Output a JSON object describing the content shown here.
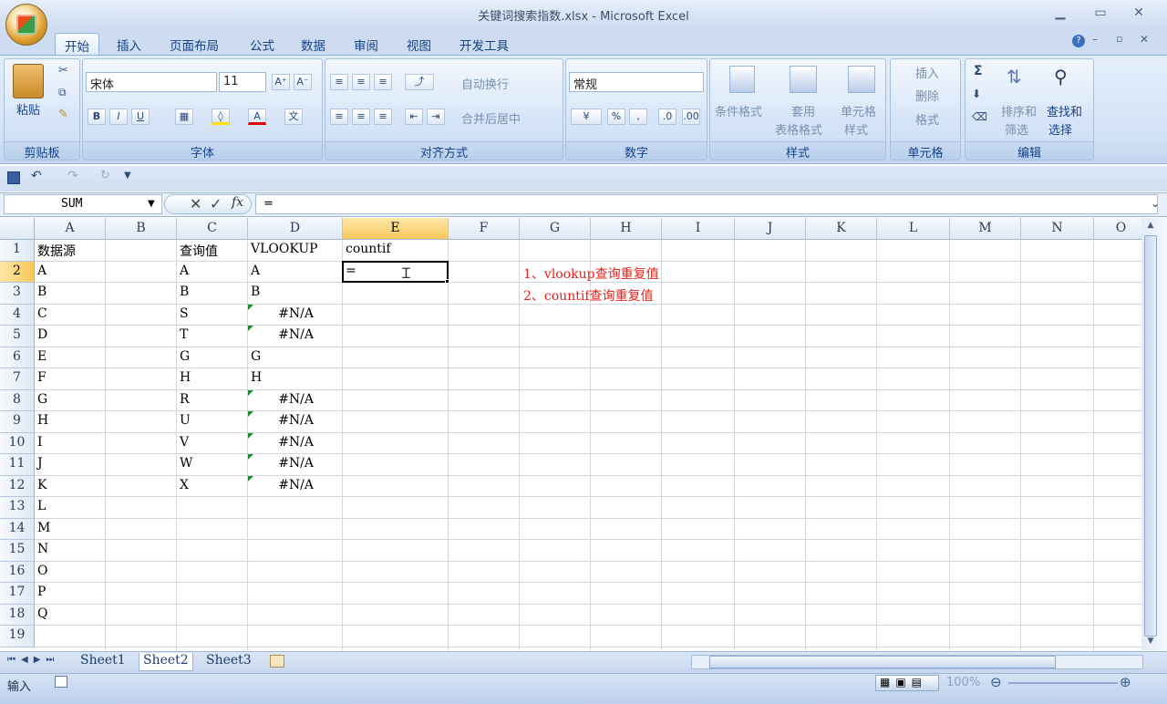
{
  "window": {
    "title": "关键词搜索指数.xlsx - Microsoft Excel"
  },
  "ribbon_tabs": [
    {
      "label": "开始",
      "active": true
    },
    {
      "label": "插入"
    },
    {
      "label": "页面布局"
    },
    {
      "label": "公式"
    },
    {
      "label": "数据"
    },
    {
      "label": "审阅"
    },
    {
      "label": "视图"
    },
    {
      "label": "开发工具"
    }
  ],
  "ribbon": {
    "clipboard": {
      "paste": "粘贴",
      "caption": "剪贴板"
    },
    "font": {
      "name": "宋体",
      "size": "11",
      "caption": "字体"
    },
    "alignment": {
      "wrap": "自动换行",
      "merge": "合并后居中",
      "caption": "对齐方式"
    },
    "number": {
      "format": "常规",
      "caption": "数字"
    },
    "styles": {
      "conditional": "条件格式",
      "table1": "套用",
      "table2": "表格格式",
      "cell1": "单元格",
      "cell2": "样式",
      "caption": "样式"
    },
    "cells": {
      "insert": "插入",
      "delete": "删除",
      "format": "格式",
      "caption": "单元格"
    },
    "editing": {
      "sort1": "排序和",
      "sort2": "筛选",
      "find1": "查找和",
      "find2": "选择",
      "caption": "编辑"
    }
  },
  "formula_bar": {
    "name_box": "SUM",
    "content": "="
  },
  "columns": [
    "A",
    "B",
    "C",
    "D",
    "E",
    "F",
    "G",
    "H",
    "I",
    "J",
    "K",
    "L",
    "M",
    "N",
    "O"
  ],
  "selected_column": "E",
  "selected_row": "2",
  "rows": [
    "1",
    "2",
    "3",
    "4",
    "5",
    "6",
    "7",
    "8",
    "9",
    "10",
    "11",
    "12",
    "13",
    "14",
    "15",
    "16",
    "17",
    "18",
    "19"
  ],
  "cells": {
    "A": [
      "数据源",
      "A",
      "B",
      "C",
      "D",
      "E",
      "F",
      "G",
      "H",
      "I",
      "J",
      "K",
      "L",
      "M",
      "N",
      "O",
      "P",
      "Q",
      ""
    ],
    "C": [
      "查询值",
      "A",
      "B",
      "S",
      "T",
      "G",
      "H",
      "R",
      "U",
      "V",
      "W",
      "X",
      "",
      "",
      "",
      "",
      "",
      "",
      ""
    ],
    "D": [
      "VLOOKUP",
      "A",
      "B",
      "#N/A",
      "#N/A",
      "G",
      "H",
      "#N/A",
      "#N/A",
      "#N/A",
      "#N/A",
      "#N/A",
      "",
      "",
      "",
      "",
      "",
      "",
      ""
    ],
    "E": [
      "countif",
      "=",
      "",
      "",
      "",
      "",
      "",
      "",
      "",
      "",
      "",
      "",
      "",
      "",
      "",
      "",
      "",
      "",
      ""
    ]
  },
  "notes": [
    "1、vlookup查询重复值",
    "2、countif查询重复值"
  ],
  "sheets": [
    {
      "name": "Sheet1"
    },
    {
      "name": "Sheet2",
      "active": true
    },
    {
      "name": "Sheet3"
    }
  ],
  "status": {
    "mode": "输入",
    "zoom": "100%"
  }
}
